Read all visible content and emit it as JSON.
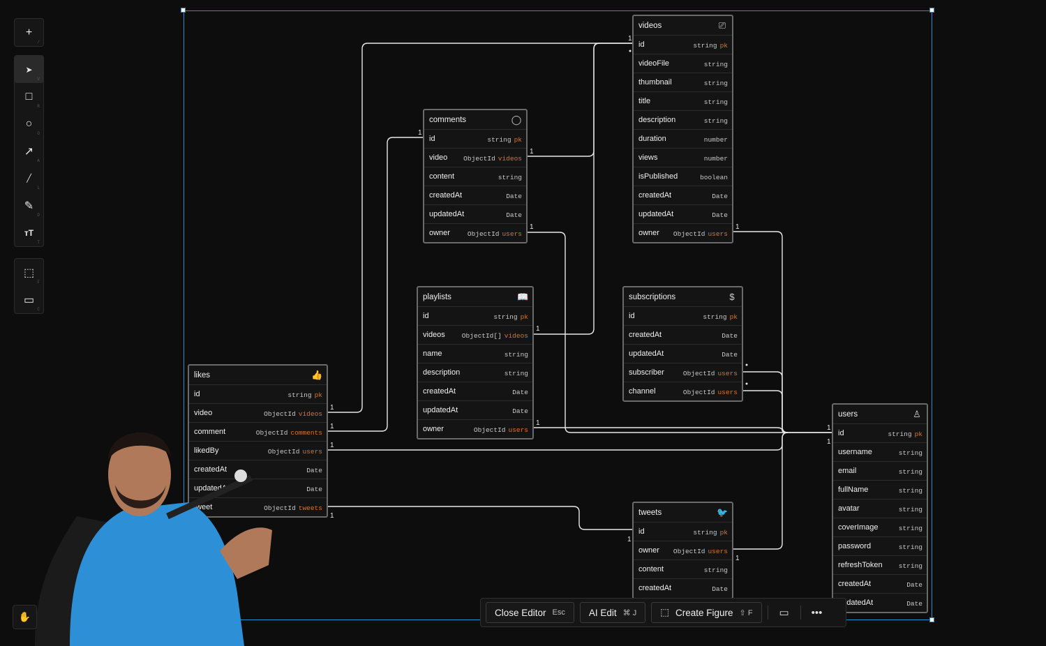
{
  "toolbar": {
    "tools": [
      {
        "name": "add",
        "icon": "plus-icon",
        "glyph": "+",
        "hotkey": "/"
      },
      {
        "name": "select",
        "icon": "pointer-icon",
        "glyph": "➤",
        "hotkey": "V"
      },
      {
        "name": "rectangle",
        "icon": "square-icon",
        "glyph": "□",
        "hotkey": "R"
      },
      {
        "name": "ellipse",
        "icon": "circle-icon",
        "glyph": "○",
        "hotkey": "O"
      },
      {
        "name": "arrow",
        "icon": "arrow-icon",
        "glyph": "↗",
        "hotkey": "A"
      },
      {
        "name": "line",
        "icon": "line-icon",
        "glyph": "╱",
        "hotkey": "L"
      },
      {
        "name": "pencil",
        "icon": "pencil-icon",
        "glyph": "✎",
        "hotkey": "D"
      },
      {
        "name": "text",
        "icon": "text-icon",
        "glyph": "ᴛT",
        "hotkey": "T"
      },
      {
        "name": "frame",
        "icon": "frame-icon",
        "glyph": "⬚",
        "hotkey": "F"
      },
      {
        "name": "comment",
        "icon": "comment-icon",
        "glyph": "▭",
        "hotkey": "C"
      }
    ]
  },
  "entities": {
    "videos": {
      "title": "videos",
      "icon": "video-camera-icon",
      "glyph": "⎚",
      "fields": [
        {
          "name": "id",
          "type": "string",
          "ref": "pk"
        },
        {
          "name": "videoFile",
          "type": "string",
          "ref": ""
        },
        {
          "name": "thumbnail",
          "type": "string",
          "ref": ""
        },
        {
          "name": "title",
          "type": "string",
          "ref": ""
        },
        {
          "name": "description",
          "type": "string",
          "ref": ""
        },
        {
          "name": "duration",
          "type": "number",
          "ref": ""
        },
        {
          "name": "views",
          "type": "number",
          "ref": ""
        },
        {
          "name": "isPublished",
          "type": "boolean",
          "ref": ""
        },
        {
          "name": "createdAt",
          "type": "Date",
          "ref": ""
        },
        {
          "name": "updatedAt",
          "type": "Date",
          "ref": ""
        },
        {
          "name": "owner",
          "type": "ObjectId",
          "ref": "users"
        }
      ]
    },
    "comments": {
      "title": "comments",
      "icon": "speech-bubble-icon",
      "glyph": "◯",
      "fields": [
        {
          "name": "id",
          "type": "string",
          "ref": "pk"
        },
        {
          "name": "video",
          "type": "ObjectId",
          "ref": "videos"
        },
        {
          "name": "content",
          "type": "string",
          "ref": ""
        },
        {
          "name": "createdAt",
          "type": "Date",
          "ref": ""
        },
        {
          "name": "updatedAt",
          "type": "Date",
          "ref": ""
        },
        {
          "name": "owner",
          "type": "ObjectId",
          "ref": "users"
        }
      ]
    },
    "playlists": {
      "title": "playlists",
      "icon": "open-book-icon",
      "glyph": "📖",
      "fields": [
        {
          "name": "id",
          "type": "string",
          "ref": "pk"
        },
        {
          "name": "videos",
          "type": "ObjectId[]",
          "ref": "videos"
        },
        {
          "name": "name",
          "type": "string",
          "ref": ""
        },
        {
          "name": "description",
          "type": "string",
          "ref": ""
        },
        {
          "name": "createdAt",
          "type": "Date",
          "ref": ""
        },
        {
          "name": "updatedAt",
          "type": "Date",
          "ref": ""
        },
        {
          "name": "owner",
          "type": "ObjectId",
          "ref": "users"
        }
      ]
    },
    "subscriptions": {
      "title": "subscriptions",
      "icon": "dollar-icon",
      "glyph": "$",
      "fields": [
        {
          "name": "id",
          "type": "string",
          "ref": "pk"
        },
        {
          "name": "createdAt",
          "type": "Date",
          "ref": ""
        },
        {
          "name": "updatedAt",
          "type": "Date",
          "ref": ""
        },
        {
          "name": "subscriber",
          "type": "ObjectId",
          "ref": "users"
        },
        {
          "name": "channel",
          "type": "ObjectId",
          "ref": "users"
        }
      ]
    },
    "likes": {
      "title": "likes",
      "icon": "thumbs-up-icon",
      "glyph": "👍",
      "fields": [
        {
          "name": "id",
          "type": "string",
          "ref": "pk"
        },
        {
          "name": "video",
          "type": "ObjectId",
          "ref": "videos"
        },
        {
          "name": "comment",
          "type": "ObjectId",
          "ref": "comments"
        },
        {
          "name": "likedBy",
          "type": "ObjectId",
          "ref": "users"
        },
        {
          "name": "createdAt",
          "type": "Date",
          "ref": ""
        },
        {
          "name": "updatedAt",
          "type": "Date",
          "ref": ""
        },
        {
          "name": "tweet",
          "type": "ObjectId",
          "ref": "tweets"
        }
      ]
    },
    "users": {
      "title": "users",
      "icon": "user-icon",
      "glyph": "♙",
      "fields": [
        {
          "name": "id",
          "type": "string",
          "ref": "pk"
        },
        {
          "name": "username",
          "type": "string",
          "ref": ""
        },
        {
          "name": "email",
          "type": "string",
          "ref": ""
        },
        {
          "name": "fullName",
          "type": "string",
          "ref": ""
        },
        {
          "name": "avatar",
          "type": "string",
          "ref": ""
        },
        {
          "name": "coverImage",
          "type": "string",
          "ref": ""
        },
        {
          "name": "password",
          "type": "string",
          "ref": ""
        },
        {
          "name": "refreshToken",
          "type": "string",
          "ref": ""
        },
        {
          "name": "createdAt",
          "type": "Date",
          "ref": ""
        },
        {
          "name": "updatedAt",
          "type": "Date",
          "ref": ""
        }
      ]
    },
    "tweets": {
      "title": "tweets",
      "icon": "bird-icon",
      "glyph": "🐦",
      "fields": [
        {
          "name": "id",
          "type": "string",
          "ref": "pk"
        },
        {
          "name": "owner",
          "type": "ObjectId",
          "ref": "users"
        },
        {
          "name": "content",
          "type": "string",
          "ref": ""
        },
        {
          "name": "createdAt",
          "type": "Date",
          "ref": ""
        }
      ]
    }
  },
  "bottom_bar": {
    "close_label": "Close Editor",
    "close_key": "Esc",
    "ai_label": "AI Edit",
    "ai_key": "⌘ J",
    "figure_label": "Create Figure",
    "figure_key": "⇧ F"
  },
  "cardinality": "1"
}
